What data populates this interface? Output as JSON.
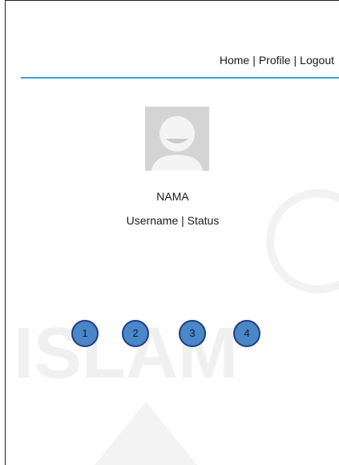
{
  "nav": {
    "home": "Home",
    "profile": "Profile",
    "logout": "Logout",
    "separator": "|"
  },
  "profile": {
    "avatar_icon": "default-user-avatar-icon",
    "name": "NAMA",
    "meta": "Username | Status"
  },
  "steps": [
    {
      "label": "1"
    },
    {
      "label": "2"
    },
    {
      "label": "3"
    },
    {
      "label": "4"
    }
  ],
  "colors": {
    "accent_rule": "#3aa4d8",
    "step_fill": "#4a86c8",
    "step_border": "#1f3f80",
    "avatar_bg": "#d4d4d4"
  }
}
